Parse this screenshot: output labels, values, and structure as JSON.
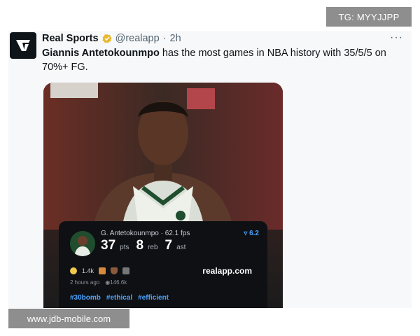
{
  "watermarks": {
    "top": "TG: MYYJJPP",
    "bottom": "www.jdb-mobile.com"
  },
  "tweet": {
    "author_name": "Real Sports",
    "handle": "@realapp",
    "separator": "·",
    "time": "2h",
    "more": "···",
    "text_bold": "Giannis Antetokounmpo",
    "text_rest": " has the most games in NBA history with 35/5/5 on 70%+ FG.",
    "icons": {
      "avatar": "real-sports-logo",
      "verified": "verified-gold-badge"
    },
    "colors": {
      "verified": "#e8b829",
      "link": "#4aa3ff"
    }
  },
  "card": {
    "player": "G. Antetokounmpo",
    "fps": "· 62.1 fps",
    "rating": "▿ 6.2",
    "stats": [
      {
        "value": "37",
        "unit": "pts"
      },
      {
        "value": "8",
        "unit": "reb"
      },
      {
        "value": "7",
        "unit": "ast"
      }
    ],
    "reaction_count": "1.4k",
    "brand": "realapp.com",
    "posted": "2 hours ago",
    "views": "146.6k",
    "hashtags": [
      "#30bomb",
      "#ethical",
      "#efficient"
    ]
  }
}
